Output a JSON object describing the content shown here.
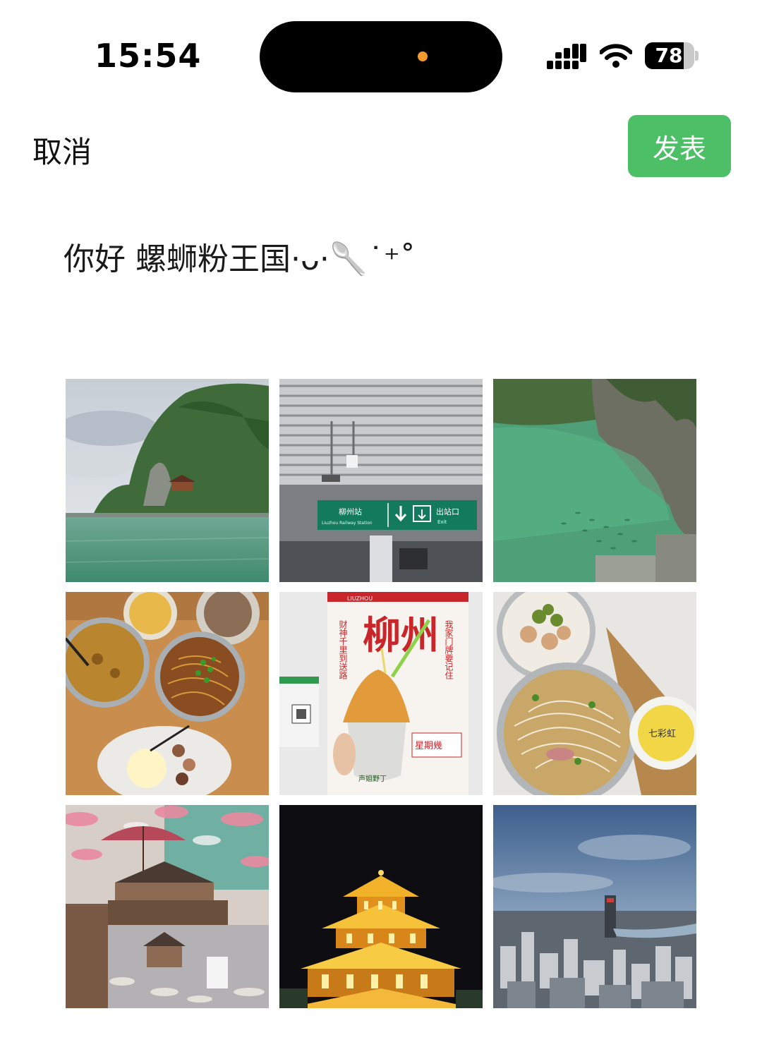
{
  "status_bar": {
    "time": "15:54",
    "battery_level": 78,
    "battery_text": "78",
    "signal_icon": "cellular-signal-icon",
    "wifi_icon": "wifi-icon",
    "island_indicator_color": "#f39a2e"
  },
  "nav": {
    "cancel_label": "取消",
    "publish_label": "发表",
    "publish_color": "#4dbf67"
  },
  "post": {
    "text": "你好 螺蛳粉王国·ᴗ·🥄˙⁺˚"
  },
  "photos": [
    {
      "subject": "karst mountain by green river"
    },
    {
      "subject": "station exit sign",
      "sign_cn": "柳州站",
      "sign_en": "Liuzhou Railway Station",
      "exit_cn": "出站口",
      "exit_en": "Exit"
    },
    {
      "subject": "jade green pool with fish"
    },
    {
      "subject": "bowls of noodles and dessert on table"
    },
    {
      "subject": "ice cream in front of poster",
      "poster_brand": "LIUZHOU",
      "poster_title": "柳州",
      "poster_text": "财神千里到送路",
      "poster_text2": "我家门牌要记住",
      "poster_day": "星期幾",
      "cup_text": "声姐野丁"
    },
    {
      "subject": "rice noodle soup with pickles and pudding",
      "cup_label": "七彩虹"
    },
    {
      "subject": "indoor market with paper umbrellas and wind-rain bridge"
    },
    {
      "subject": "illuminated tower at night"
    },
    {
      "subject": "city skyline under cloudy sky"
    }
  ]
}
